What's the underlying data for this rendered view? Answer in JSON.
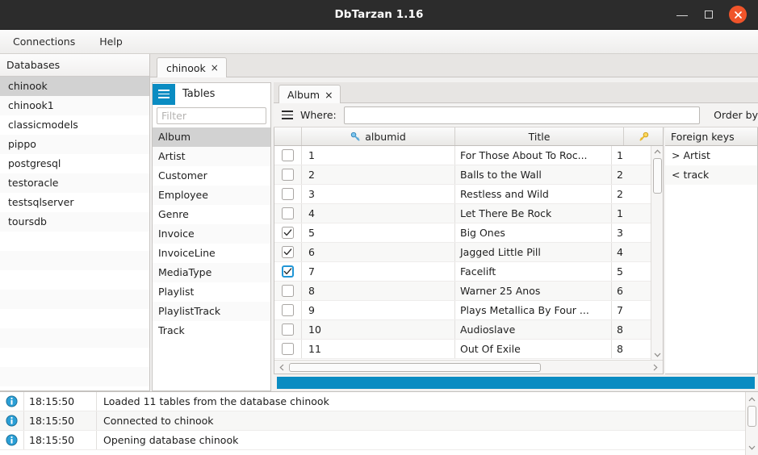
{
  "window": {
    "title": "DbTarzan 1.16",
    "minimize_label": "Minimize",
    "maximize_label": "Maximize",
    "close_label": "Close"
  },
  "menubar": {
    "items": [
      {
        "label": "Connections"
      },
      {
        "label": "Help"
      }
    ]
  },
  "databases": {
    "header": "Databases",
    "items": [
      {
        "label": "chinook",
        "selected": true
      },
      {
        "label": "chinook1",
        "selected": false
      },
      {
        "label": "classicmodels",
        "selected": false
      },
      {
        "label": "pippo",
        "selected": false
      },
      {
        "label": "postgresql",
        "selected": false
      },
      {
        "label": "testoracle",
        "selected": false
      },
      {
        "label": "testsqlserver",
        "selected": false
      },
      {
        "label": "toursdb",
        "selected": false
      }
    ]
  },
  "db_tabs": [
    {
      "label": "chinook",
      "close": "×",
      "active": true
    }
  ],
  "tables": {
    "menu_icon": "hamburger-icon",
    "title": "Tables",
    "filter_placeholder": "Filter",
    "filter_value": "",
    "items": [
      {
        "label": "Album",
        "selected": true
      },
      {
        "label": "Artist",
        "selected": false
      },
      {
        "label": "Customer",
        "selected": false
      },
      {
        "label": "Employee",
        "selected": false
      },
      {
        "label": "Genre",
        "selected": false
      },
      {
        "label": "Invoice",
        "selected": false
      },
      {
        "label": "InvoiceLine",
        "selected": false
      },
      {
        "label": "MediaType",
        "selected": false
      },
      {
        "label": "Playlist",
        "selected": false
      },
      {
        "label": "PlaylistTrack",
        "selected": false
      },
      {
        "label": "Track",
        "selected": false
      }
    ]
  },
  "table_tabs": [
    {
      "label": "Album",
      "close": "×",
      "active": true
    }
  ],
  "query_bar": {
    "menu_icon": "hamburger-icon",
    "where_label": "Where:",
    "where_value": "",
    "where_placeholder": "",
    "order_by_label": "Order by"
  },
  "grid": {
    "columns": [
      {
        "key": "check",
        "label": "",
        "icon": ""
      },
      {
        "key": "albumid",
        "label": "albumid",
        "icon": "key-icon-blue"
      },
      {
        "key": "title",
        "label": "Title",
        "icon": ""
      },
      {
        "key": "artistid",
        "label": "",
        "icon": "key-icon-gold"
      }
    ],
    "rows": [
      {
        "checked": false,
        "focused": false,
        "albumid": "1",
        "title": "For Those About To Roc...",
        "artistid": "1"
      },
      {
        "checked": false,
        "focused": false,
        "albumid": "2",
        "title": "Balls to the Wall",
        "artistid": "2"
      },
      {
        "checked": false,
        "focused": false,
        "albumid": "3",
        "title": "Restless and Wild",
        "artistid": "2"
      },
      {
        "checked": false,
        "focused": false,
        "albumid": "4",
        "title": "Let There Be Rock",
        "artistid": "1"
      },
      {
        "checked": true,
        "focused": false,
        "albumid": "5",
        "title": "Big Ones",
        "artistid": "3"
      },
      {
        "checked": true,
        "focused": false,
        "albumid": "6",
        "title": "Jagged Little Pill",
        "artistid": "4"
      },
      {
        "checked": true,
        "focused": true,
        "albumid": "7",
        "title": "Facelift",
        "artistid": "5"
      },
      {
        "checked": false,
        "focused": false,
        "albumid": "8",
        "title": "Warner 25 Anos",
        "artistid": "6"
      },
      {
        "checked": false,
        "focused": false,
        "albumid": "9",
        "title": "Plays Metallica By Four ...",
        "artistid": "7"
      },
      {
        "checked": false,
        "focused": false,
        "albumid": "10",
        "title": "Audioslave",
        "artistid": "8"
      },
      {
        "checked": false,
        "focused": false,
        "albumid": "11",
        "title": "Out Of Exile",
        "artistid": "8"
      }
    ]
  },
  "foreign_keys": {
    "header": "Foreign keys",
    "items": [
      {
        "label": "> Artist"
      },
      {
        "label": "< track"
      }
    ]
  },
  "progress": {
    "color": "#0a8cc2",
    "percent": 100
  },
  "log": {
    "entries": [
      {
        "icon": "info-icon",
        "time": "18:15:50",
        "message": "Loaded 11 tables from the database chinook"
      },
      {
        "icon": "info-icon",
        "time": "18:15:50",
        "message": "Connected to chinook"
      },
      {
        "icon": "info-icon",
        "time": "18:15:50",
        "message": "Opening database chinook"
      }
    ]
  }
}
